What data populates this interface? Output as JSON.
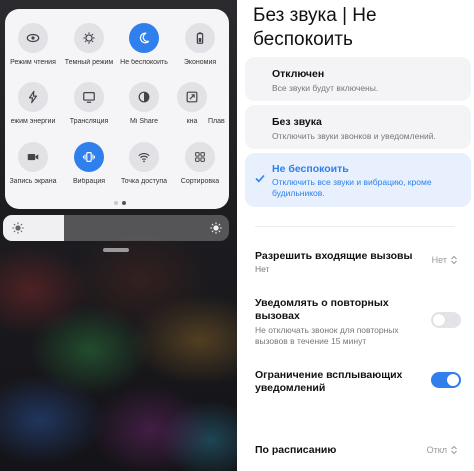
{
  "quick_settings": {
    "tiles": [
      {
        "label": "Режим чтения",
        "icon": "eye-icon",
        "active": false
      },
      {
        "label": "Темный режим",
        "icon": "dark-mode-icon",
        "active": false
      },
      {
        "label": "Не беспокоить",
        "icon": "moon-icon",
        "active": true
      },
      {
        "label": "Экономия",
        "icon": "battery-icon",
        "active": false
      },
      {
        "label": "ежим энергии",
        "icon": "lightning-icon",
        "active": false
      },
      {
        "label": "Трансляция",
        "icon": "cast-icon",
        "active": false
      },
      {
        "label": "Mi Share",
        "icon": "mi-share-icon",
        "active": false
      },
      {
        "label": "кна",
        "icon": "window-icon",
        "active": false
      },
      {
        "label": "Плав",
        "icon": "floating-icon",
        "active": false
      },
      {
        "label": "Запись экрана",
        "icon": "video-camera-icon",
        "active": false
      },
      {
        "label": "Вибрация",
        "icon": "vibration-icon",
        "active": true
      },
      {
        "label": "Точка доступа",
        "icon": "hotspot-icon",
        "active": false
      },
      {
        "label": "Сортировка",
        "icon": "grid-icon",
        "active": false
      }
    ],
    "page_indicator": {
      "pages": 2,
      "current": 2
    },
    "brightness_level": 0.27,
    "accent_color": "#2f80ed"
  },
  "settings": {
    "title": "Без звука | Не беспокоить",
    "modes": [
      {
        "title": "Отключен",
        "description": "Все звуки будут включены.",
        "selected": false
      },
      {
        "title": "Без звука",
        "description": "Отключить звуки звонков и уведомлений.",
        "selected": false
      },
      {
        "title": "Не беспокоить",
        "description": "Отключить все звуки и вибрацию, кроме будильников.",
        "selected": true
      }
    ],
    "allow_calls": {
      "title": "Разрешить входящие вызовы",
      "subtitle": "Нет",
      "value": "Нет"
    },
    "repeat_calls": {
      "title": "Уведомлять о повторных вызовах",
      "description": "Не отключать звонок для повторных вызовов в течение 15 минут",
      "enabled": false
    },
    "limit_popups": {
      "title": "Ограничение всплывающих уведомлений",
      "enabled": true
    },
    "schedule": {
      "title": "По расписанию",
      "value": "Откл"
    }
  }
}
